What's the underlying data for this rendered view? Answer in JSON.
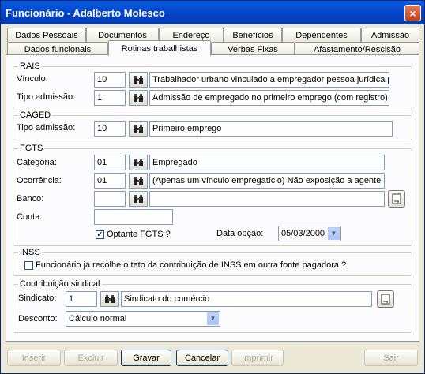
{
  "window": {
    "title": "Funcionário - Adalberto Molesco",
    "close_glyph": "×"
  },
  "tabs_row1": [
    "Dados Pessoais",
    "Documentos",
    "Endereço",
    "Benefícios",
    "Dependentes",
    "Admissão"
  ],
  "tabs_row2": [
    "Dados funcionais",
    "Rotinas trabalhistas",
    "Verbas Fixas",
    "Afastamento/Rescisão"
  ],
  "active_tab": "Rotinas trabalhistas",
  "rais": {
    "title": "RAIS",
    "vinculo_label": "Vínculo:",
    "vinculo_code": "10",
    "vinculo_desc": "Trabalhador urbano vinculado a empregador pessoa jurídica p",
    "tipo_label": "Tipo admissão:",
    "tipo_code": "1",
    "tipo_desc": "Admissão de empregado no primeiro emprego (com registro)"
  },
  "caged": {
    "title": "CAGED",
    "tipo_label": "Tipo admissão:",
    "tipo_code": "10",
    "tipo_desc": "Primeiro emprego"
  },
  "fgts": {
    "title": "FGTS",
    "categoria_label": "Categoria:",
    "categoria_code": "01",
    "categoria_desc": "Empregado",
    "ocorrencia_label": "Ocorrência:",
    "ocorrencia_code": "01",
    "ocorrencia_desc": "(Apenas um vínculo empregatício) Não exposição a agente no",
    "banco_label": "Banco:",
    "banco_code": "",
    "banco_desc": "",
    "conta_label": "Conta:",
    "conta_value": "",
    "optante_label": "Optante FGTS ?",
    "optante_checked": true,
    "data_opcao_label": "Data opção:",
    "data_opcao_value": "05/03/2000"
  },
  "inss": {
    "title": "INSS",
    "teto_label": "Funcionário já recolhe o teto da contribuição de INSS em outra fonte pagadora ?",
    "teto_checked": false
  },
  "sindical": {
    "title": "Contribuição sindical",
    "sindicato_label": "Sindicato:",
    "sindicato_code": "1",
    "sindicato_desc": "Sindicato do comércio",
    "desconto_label": "Desconto:",
    "desconto_value": "Cálculo normal"
  },
  "buttons": {
    "inserir": "Inserir",
    "excluir": "Excluir",
    "gravar": "Gravar",
    "cancelar": "Cancelar",
    "imprimir": "Imprimir",
    "sair": "Sair"
  }
}
